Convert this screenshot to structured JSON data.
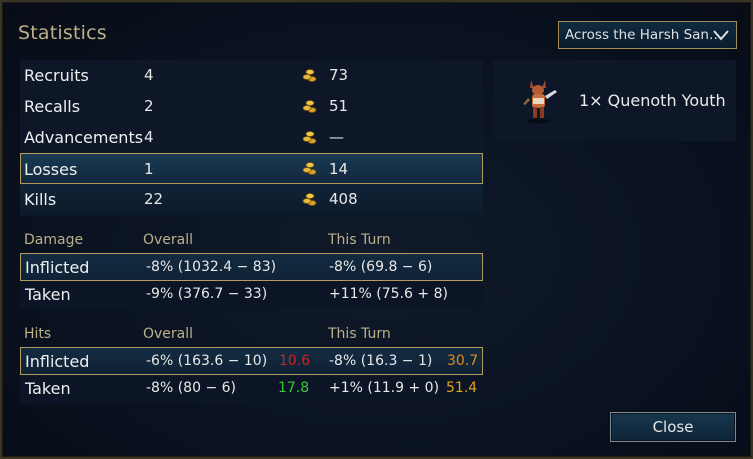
{
  "window": {
    "title": "Statistics"
  },
  "scenario_select": {
    "value": "Across the Harsh San…"
  },
  "stats": {
    "rows": [
      {
        "label": "Recruits",
        "value": "4",
        "cost": "73"
      },
      {
        "label": "Recalls",
        "value": "2",
        "cost": "51"
      },
      {
        "label": "Advancements",
        "value": "4",
        "cost": "—"
      },
      {
        "label": "Losses",
        "value": "1",
        "cost": "14"
      },
      {
        "label": "Kills",
        "value": "22",
        "cost": "408"
      }
    ]
  },
  "unit_list": {
    "entry": "1× Quenoth Youth"
  },
  "damage": {
    "header": {
      "label": "Damage",
      "overall": "Overall",
      "this_turn": "This Turn"
    },
    "rows": [
      {
        "label": "Inflicted",
        "overall": "-8% (1032.4 − 83)",
        "this_turn": "-8% (69.8 − 6)"
      },
      {
        "label": "Taken",
        "overall": "-9% (376.7 − 33)",
        "this_turn": "+11% (75.6 + 8)"
      }
    ]
  },
  "hits": {
    "header": {
      "label": "Hits",
      "overall": "Overall",
      "this_turn": "This Turn"
    },
    "rows": [
      {
        "label": "Inflicted",
        "overall": "-6% (163.6 − 10)",
        "overall_rating": "10.6",
        "this_turn": "-8% (16.3 − 1)",
        "this_turn_rating": "30.7"
      },
      {
        "label": "Taken",
        "overall": "-8% (80 − 6)",
        "overall_rating": "17.8",
        "this_turn": "+1% (11.9 + 0)",
        "this_turn_rating": "51.4"
      }
    ]
  },
  "buttons": {
    "close": "Close"
  },
  "colors": {
    "header_gold": "#bcb088",
    "highlight_border": "#b59b5d",
    "rating_red": "#d52020",
    "rating_green": "#3cc43c",
    "rating_orange": "#e08a1a",
    "rating_amber": "#e6a11d"
  },
  "icons": {
    "gold": "gold-coins-icon",
    "dropdown": "chevron-down-icon"
  }
}
